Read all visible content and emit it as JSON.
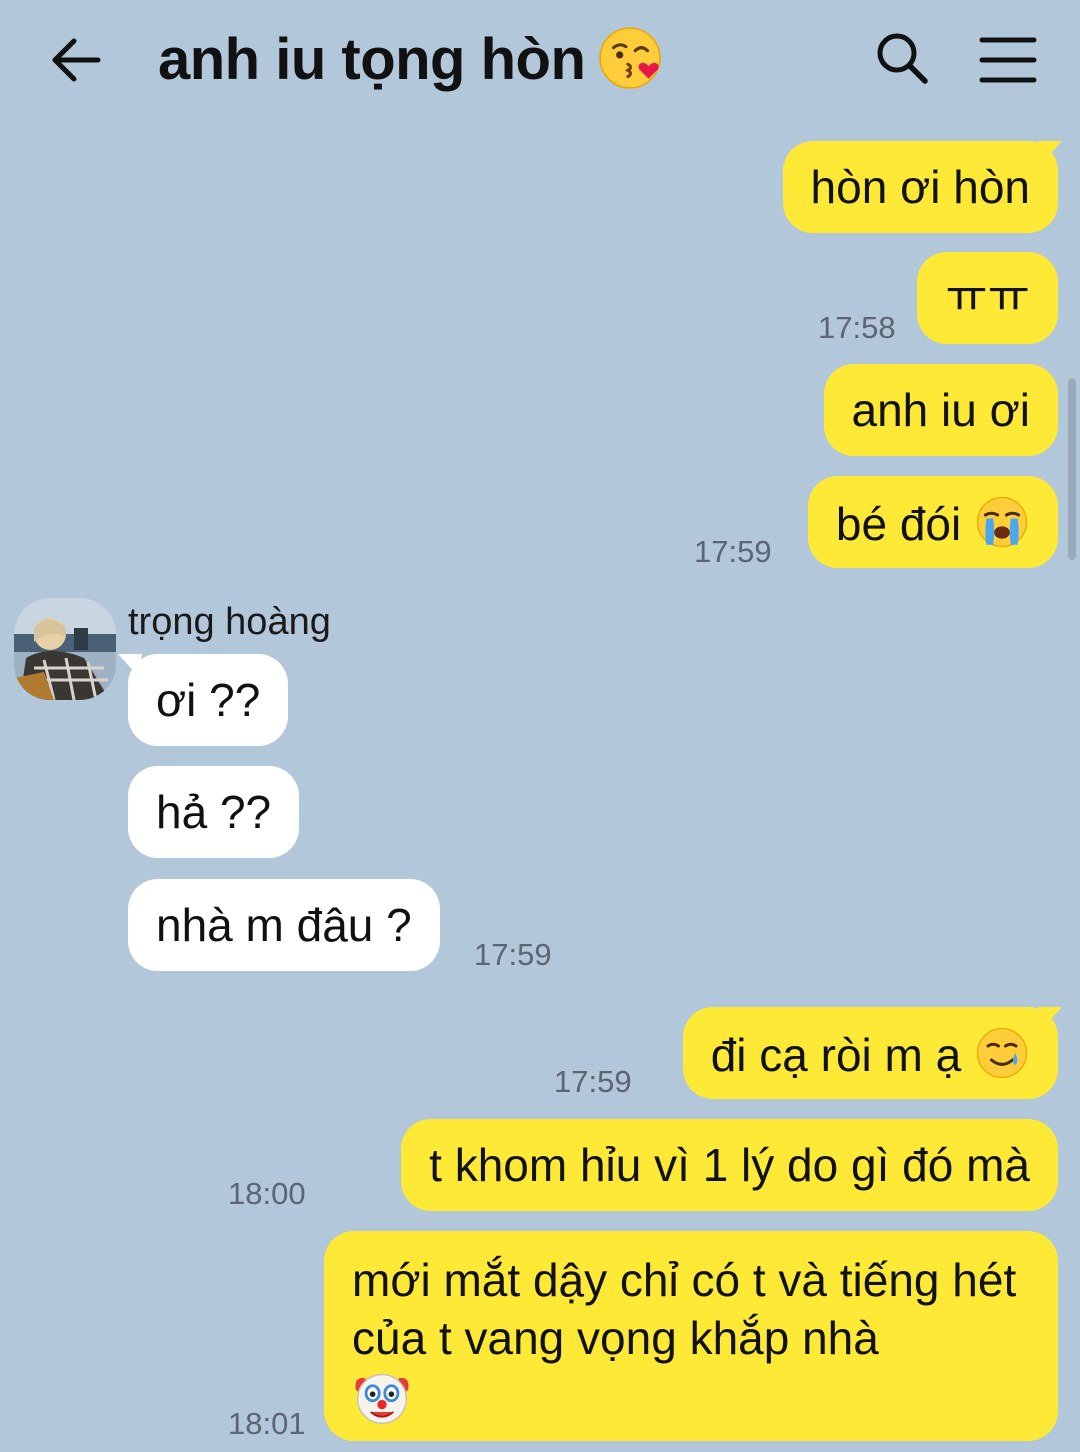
{
  "header": {
    "title": "anh iu tọng hòn",
    "title_emoji": "face-blowing-kiss-icon",
    "back_icon": "back-arrow-icon",
    "search_icon": "search-icon",
    "menu_icon": "menu-icon"
  },
  "contact": {
    "name": "trọng hoàng",
    "avatar": "avatar-photo"
  },
  "messages": [
    {
      "from": "me",
      "text": "hòn ơi hòn",
      "time": ""
    },
    {
      "from": "me",
      "text": "ㅠㅠ",
      "time": "17:58"
    },
    {
      "from": "me",
      "text": "anh iu ơi",
      "time": ""
    },
    {
      "from": "me",
      "text": "bé đói",
      "emoji": "loudly-crying-face-icon",
      "time": "17:59"
    },
    {
      "from": "them",
      "text": "ơi ??",
      "time": ""
    },
    {
      "from": "them",
      "text": "hả ??",
      "time": ""
    },
    {
      "from": "them",
      "text": "nhà m đâu ?",
      "time": "17:59"
    },
    {
      "from": "me",
      "text": "đi cạ ròi m ạ",
      "emoji": "smiling-face-with-tear-icon",
      "time": "17:59"
    },
    {
      "from": "me",
      "text": "t khom hỉu vì 1 lý do gì đó mà",
      "time": "18:00"
    },
    {
      "from": "me",
      "text": "mới mắt dậy chỉ có t và tiếng hét của t vang vọng khắp nhà",
      "emoji": "clown-face-icon",
      "time": "18:01"
    }
  ],
  "colors": {
    "background": "#b2c7da",
    "my_bubble": "#fde936",
    "their_bubble": "#ffffff",
    "timestamp": "#5c6570"
  }
}
